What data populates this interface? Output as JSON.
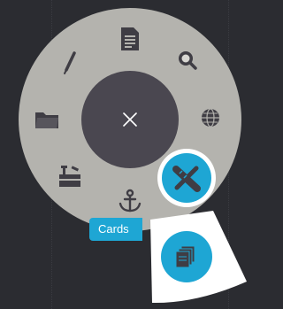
{
  "radial_menu": {
    "center_button": {
      "icon": "close-icon"
    },
    "items": [
      {
        "icon": "document-icon"
      },
      {
        "icon": "search-icon"
      },
      {
        "icon": "globe-icon"
      },
      {
        "icon": "pencil-icon"
      },
      {
        "icon": "folder-icon"
      },
      {
        "icon": "toolbox-icon"
      },
      {
        "icon": "anchor-icon"
      },
      {
        "icon": "ruler-pencil-icon",
        "state": "highlighted"
      }
    ],
    "submenu": {
      "tooltip": "Cards",
      "item_icon": "cards-icon"
    }
  },
  "colors": {
    "background": "#2b2c31",
    "ring": "#b4b3ae",
    "center": "#4a4750",
    "accent": "#1ea6d4",
    "icon": "#3f3d44"
  }
}
